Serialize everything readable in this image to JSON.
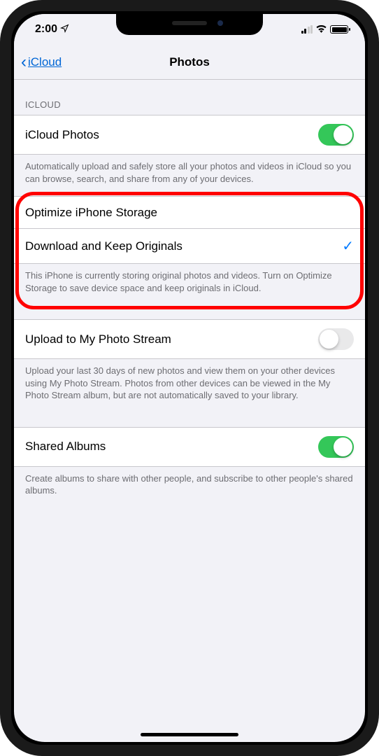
{
  "status": {
    "time": "2:00"
  },
  "nav": {
    "back": "iCloud",
    "title": "Photos"
  },
  "section1": {
    "header": "ICLOUD",
    "row_label": "iCloud Photos",
    "footer": "Automatically upload and safely store all your photos and videos in iCloud so you can browse, search, and share from any of your devices."
  },
  "section2": {
    "row1": "Optimize iPhone Storage",
    "row2": "Download and Keep Originals",
    "footer": "This iPhone is currently storing original photos and videos. Turn on Optimize Storage to save device space and keep originals in iCloud."
  },
  "section3": {
    "row_label": "Upload to My Photo Stream",
    "footer": "Upload your last 30 days of new photos and view them on your other devices using My Photo Stream. Photos from other devices can be viewed in the My Photo Stream album, but are not automatically saved to your library."
  },
  "section4": {
    "row_label": "Shared Albums",
    "footer": "Create albums to share with other people, and subscribe to other people's shared albums."
  }
}
